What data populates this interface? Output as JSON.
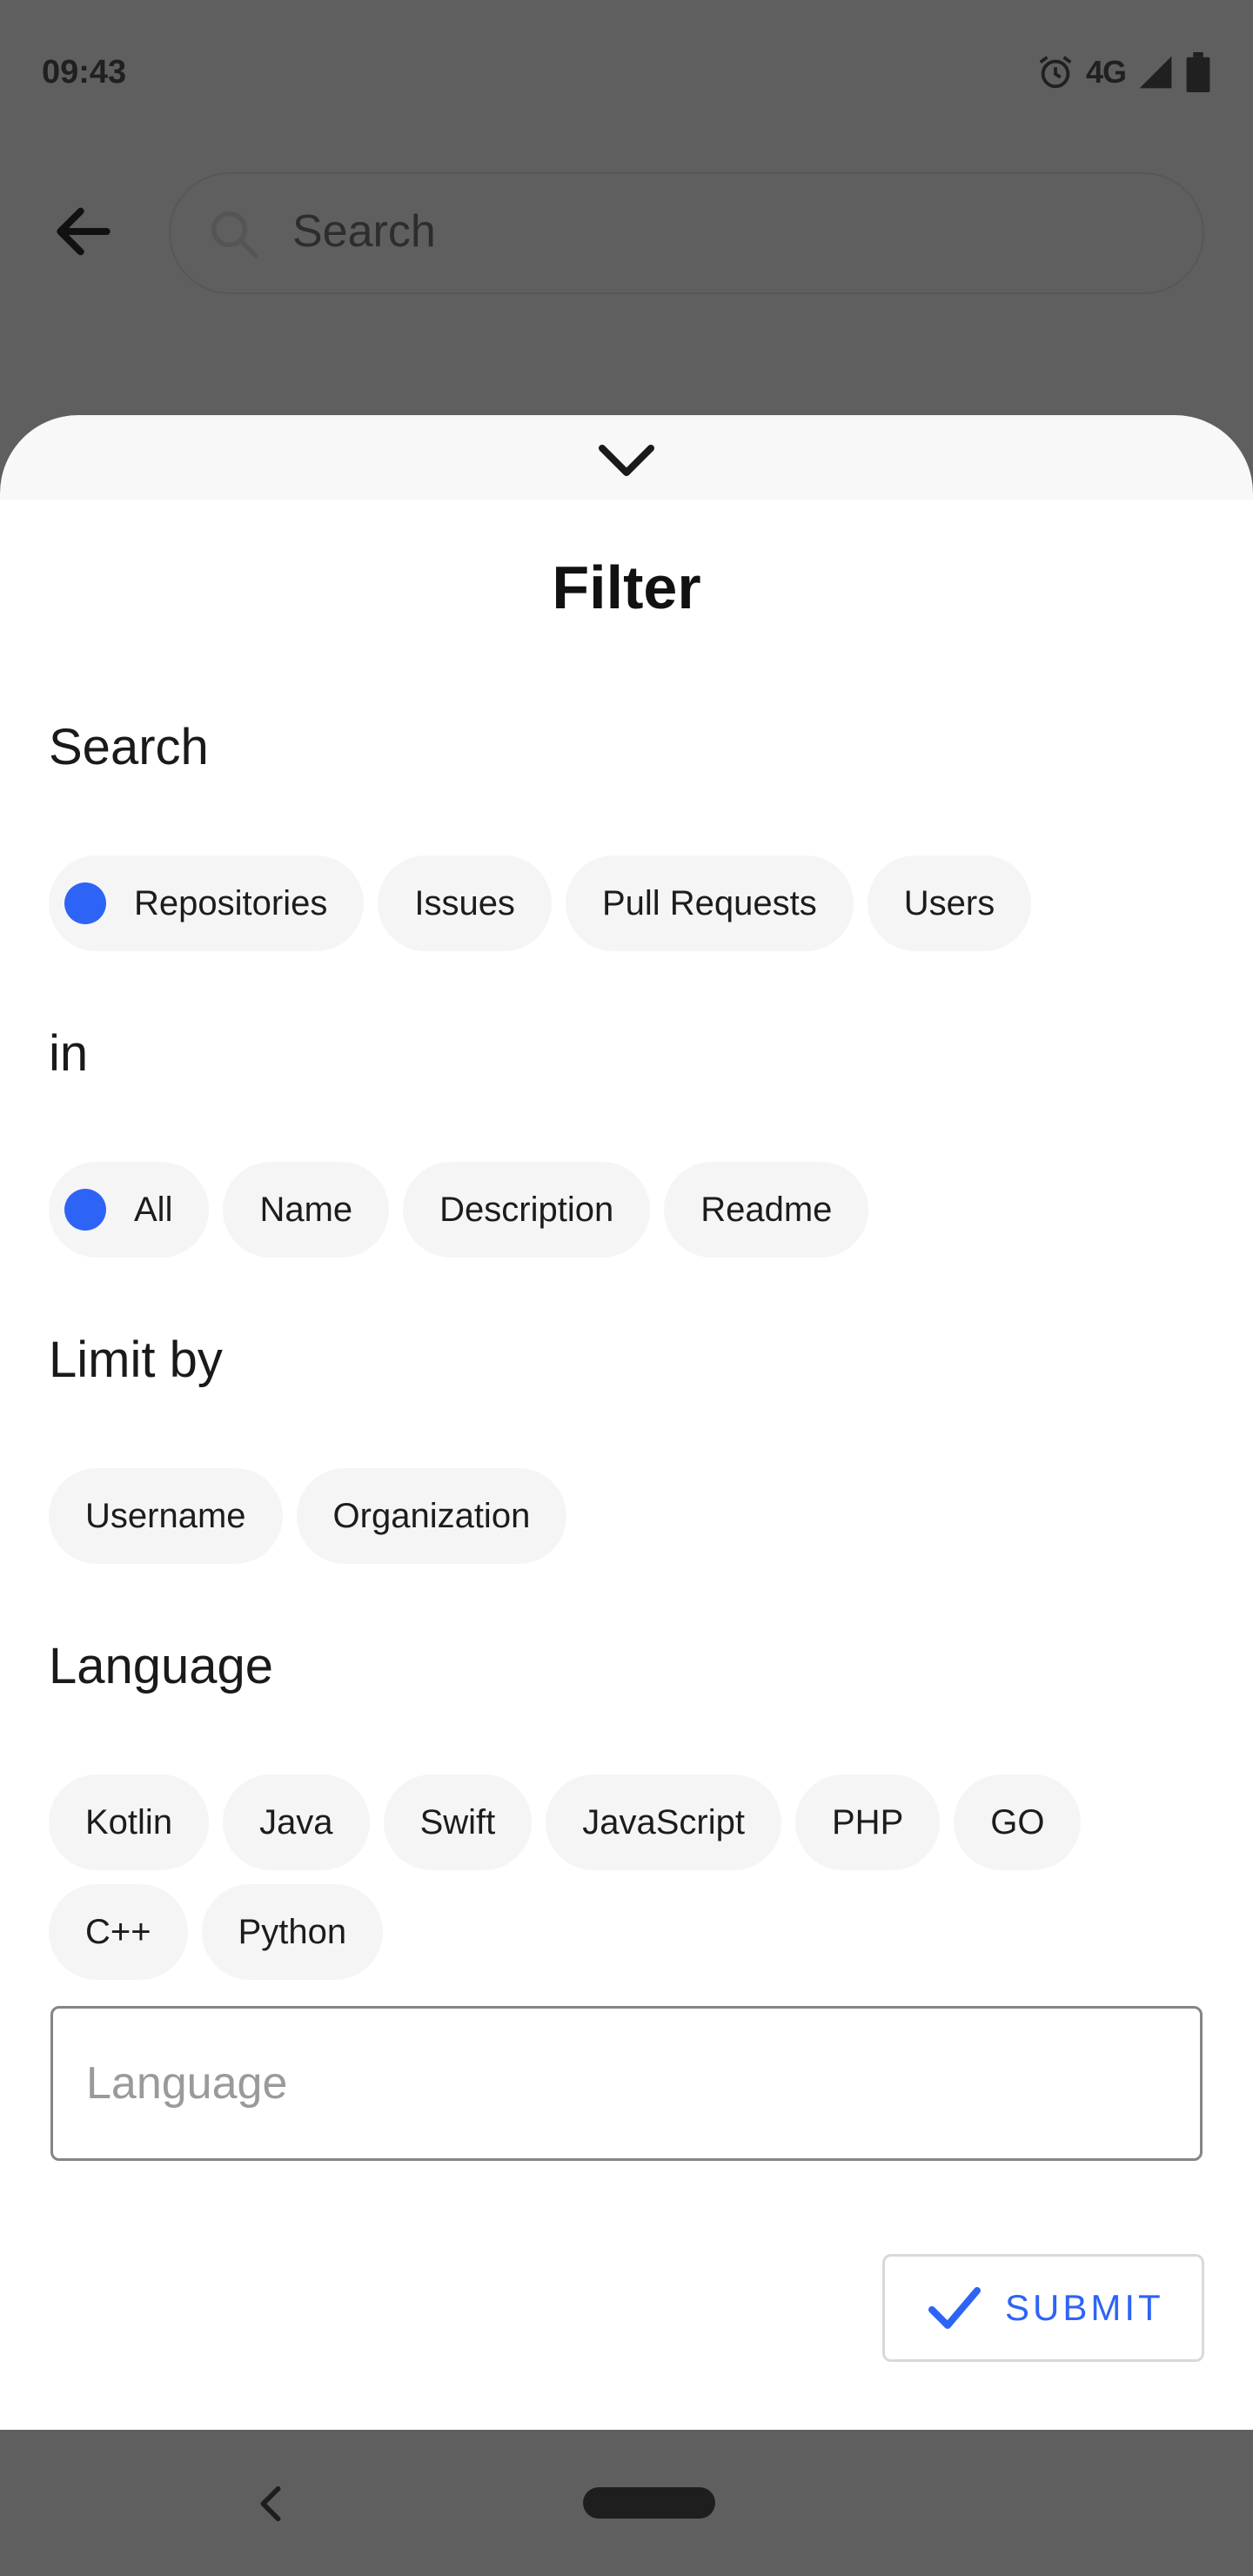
{
  "status_bar": {
    "time": "09:43",
    "network": "4G",
    "icons": [
      "alarm-icon",
      "signal-icon",
      "battery-icon"
    ]
  },
  "header": {
    "search_placeholder": "Search"
  },
  "sheet": {
    "title": "Filter",
    "sections": {
      "search": {
        "label": "Search",
        "chips": [
          "Repositories",
          "Issues",
          "Pull Requests",
          "Users"
        ],
        "selected": "Repositories"
      },
      "in": {
        "label": "in",
        "chips": [
          "All",
          "Name",
          "Description",
          "Readme"
        ],
        "selected": "All"
      },
      "limit_by": {
        "label": "Limit by",
        "chips": [
          "Username",
          "Organization"
        ]
      },
      "language": {
        "label": "Language",
        "chips": [
          "Kotlin",
          "Java",
          "Swift",
          "JavaScript",
          "PHP",
          "GO",
          "C++",
          "Python"
        ],
        "input_placeholder": "Language"
      }
    },
    "submit_label": "SUBMIT"
  },
  "colors": {
    "accent": "#2e64f5",
    "chip_bg": "#f5f5f5",
    "scrim": "#5f5f5f"
  }
}
